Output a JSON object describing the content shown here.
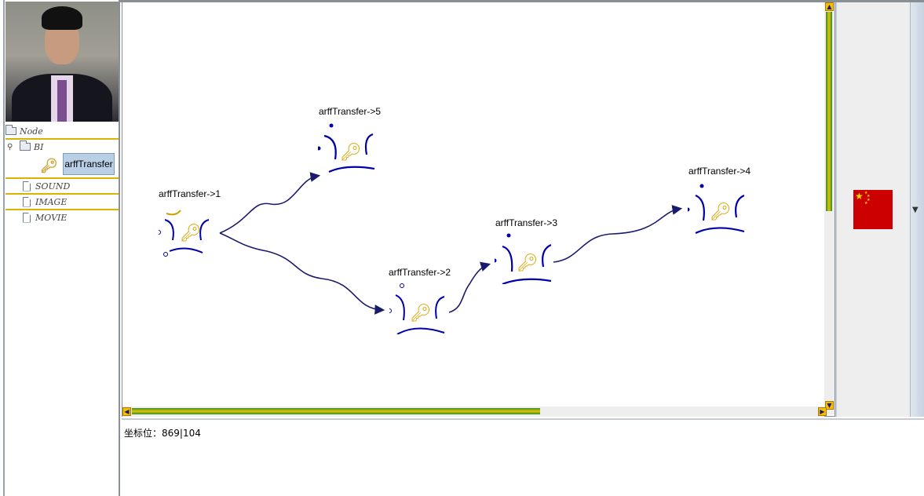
{
  "avatar": {
    "alt": "user photo"
  },
  "tree": {
    "root": "Node",
    "items": [
      {
        "label": "BI",
        "type": "folder",
        "children": [
          {
            "label": "arffTransfer",
            "selected": true
          }
        ]
      },
      {
        "label": "SOUND",
        "type": "page"
      },
      {
        "label": "IMAGE",
        "type": "page"
      },
      {
        "label": "MOVIE",
        "type": "page"
      }
    ]
  },
  "canvas": {
    "nodes": [
      {
        "id": "n1",
        "label": "arffTransfer->1"
      },
      {
        "id": "n5",
        "label": "arffTransfer->5"
      },
      {
        "id": "n2",
        "label": "arffTransfer->2"
      },
      {
        "id": "n3",
        "label": "arffTransfer->3"
      },
      {
        "id": "n4",
        "label": "arffTransfer->4"
      }
    ],
    "edges": [
      [
        "n1",
        "n5"
      ],
      [
        "n1",
        "n2"
      ],
      [
        "n2",
        "n3"
      ],
      [
        "n3",
        "n4"
      ]
    ]
  },
  "status": {
    "coordinate_label": "坐标位：869|104"
  },
  "language": {
    "flag": "china-flag-icon"
  },
  "colors": {
    "edge": "#1a1a6e",
    "node_arc": "#0000aa",
    "accent": "#d9a400"
  }
}
